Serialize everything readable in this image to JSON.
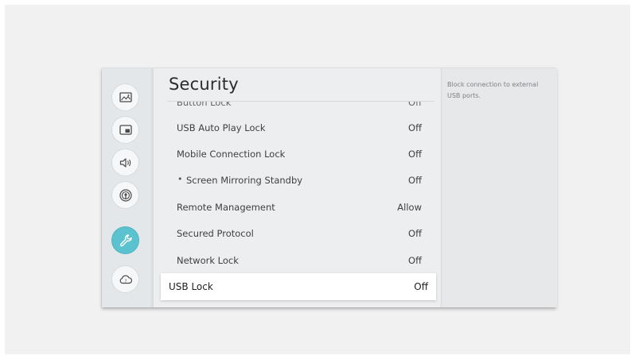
{
  "colors": {
    "accent": "#5bc2cf",
    "panel_bg": "#eceeef",
    "sidebar_bg": "#e4e7e9",
    "focus_bg": "#ffffff"
  },
  "sidebar": {
    "items": [
      {
        "icon": "picture-icon"
      },
      {
        "icon": "screen-mode-icon"
      },
      {
        "icon": "sound-icon"
      },
      {
        "icon": "network-icon"
      },
      {
        "icon": "wrench-icon",
        "active": true
      },
      {
        "icon": "cloud-support-icon"
      }
    ]
  },
  "security": {
    "title": "Security",
    "rows": [
      {
        "label": "Button Lock",
        "value": "Off"
      },
      {
        "label": "USB Auto Play Lock",
        "value": "Off"
      },
      {
        "label": "Mobile Connection Lock",
        "value": "Off"
      },
      {
        "label": "Screen Mirroring Standby",
        "value": "Off",
        "bullet": "•"
      },
      {
        "label": "Remote Management",
        "value": "Allow"
      },
      {
        "label": "Secured Protocol",
        "value": "Off"
      },
      {
        "label": "Network Lock",
        "value": "Off"
      },
      {
        "label": "USB Lock",
        "value": "Off",
        "focused": true
      }
    ]
  },
  "help": {
    "text": "Block connection to external USB ports."
  }
}
